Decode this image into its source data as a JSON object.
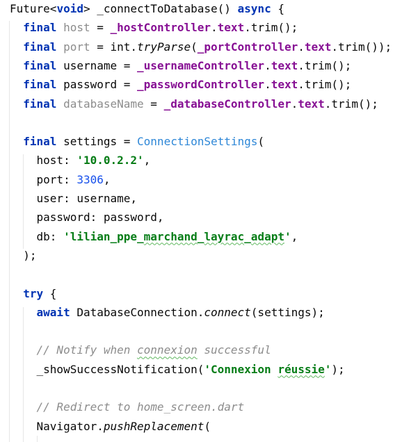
{
  "editor": {
    "lines": [
      [
        [
          "Future<",
          ""
        ],
        [
          "void",
          "kw"
        ],
        [
          "> _connectToDatabase() ",
          ""
        ],
        [
          "async",
          "kw"
        ],
        [
          " {",
          ""
        ]
      ],
      [
        [
          "  ",
          ""
        ],
        [
          "final",
          "kw"
        ],
        [
          " ",
          ""
        ],
        [
          "host",
          "unused"
        ],
        [
          " = ",
          ""
        ],
        [
          "_hostController",
          "field"
        ],
        [
          ".",
          ""
        ],
        [
          "text",
          "field"
        ],
        [
          ".trim();",
          ""
        ]
      ],
      [
        [
          "  ",
          ""
        ],
        [
          "final",
          "kw"
        ],
        [
          " ",
          ""
        ],
        [
          "port",
          "unused"
        ],
        [
          " = int.",
          ""
        ],
        [
          "tryParse",
          "call"
        ],
        [
          "(",
          ""
        ],
        [
          "_portController",
          "field"
        ],
        [
          ".",
          ""
        ],
        [
          "text",
          "field"
        ],
        [
          ".trim());",
          ""
        ]
      ],
      [
        [
          "  ",
          ""
        ],
        [
          "final",
          "kw"
        ],
        [
          " username = ",
          ""
        ],
        [
          "_usernameController",
          "field"
        ],
        [
          ".",
          ""
        ],
        [
          "text",
          "field"
        ],
        [
          ".trim();",
          ""
        ]
      ],
      [
        [
          "  ",
          ""
        ],
        [
          "final",
          "kw"
        ],
        [
          " password = ",
          ""
        ],
        [
          "_passwordController",
          "field"
        ],
        [
          ".",
          ""
        ],
        [
          "text",
          "field"
        ],
        [
          ".trim();",
          ""
        ]
      ],
      [
        [
          "  ",
          ""
        ],
        [
          "final",
          "kw"
        ],
        [
          " ",
          ""
        ],
        [
          "databaseName",
          "unused"
        ],
        [
          " = ",
          ""
        ],
        [
          "_databaseController",
          "field"
        ],
        [
          ".",
          ""
        ],
        [
          "text",
          "field"
        ],
        [
          ".trim();",
          ""
        ]
      ],
      [],
      [
        [
          "  ",
          ""
        ],
        [
          "final",
          "kw"
        ],
        [
          " settings = ",
          ""
        ],
        [
          "ConnectionSettings",
          "cls"
        ],
        [
          "(",
          ""
        ]
      ],
      [
        [
          "    host: ",
          ""
        ],
        [
          "'10.0.2.2'",
          "str"
        ],
        [
          ",",
          ""
        ]
      ],
      [
        [
          "    port: ",
          ""
        ],
        [
          "3306",
          "num"
        ],
        [
          ",",
          ""
        ]
      ],
      [
        [
          "    user: username,",
          ""
        ]
      ],
      [
        [
          "    password: password,",
          ""
        ]
      ],
      [
        [
          "    db: ",
          ""
        ],
        [
          "'lilian_ppe_",
          "str"
        ],
        [
          "marchand",
          "str typo"
        ],
        [
          "_",
          "str"
        ],
        [
          "layrac",
          "str typo"
        ],
        [
          "_",
          "str"
        ],
        [
          "adapt",
          "str typo"
        ],
        [
          "'",
          "str"
        ],
        [
          ",",
          ""
        ]
      ],
      [
        [
          "  );",
          ""
        ]
      ],
      [],
      [
        [
          "  ",
          ""
        ],
        [
          "try",
          "kw"
        ],
        [
          " {",
          ""
        ]
      ],
      [
        [
          "    ",
          ""
        ],
        [
          "await",
          "kw"
        ],
        [
          " DatabaseConnection.",
          ""
        ],
        [
          "connect",
          "call"
        ],
        [
          "(settings);",
          ""
        ]
      ],
      [],
      [
        [
          "    ",
          ""
        ],
        [
          "// Notify when ",
          "comment"
        ],
        [
          "connexion",
          "comment typo"
        ],
        [
          " successful",
          "comment"
        ]
      ],
      [
        [
          "    _showSuccessNotification(",
          ""
        ],
        [
          "'Connexion ",
          "str"
        ],
        [
          "réussie",
          "str typo"
        ],
        [
          "'",
          "str"
        ],
        [
          ");",
          ""
        ]
      ],
      [],
      [
        [
          "    ",
          ""
        ],
        [
          "// Redirect to home_screen.dart",
          "comment"
        ]
      ],
      [
        [
          "    Navigator.",
          ""
        ],
        [
          "pushReplacement",
          "call"
        ],
        [
          "(",
          ""
        ]
      ]
    ]
  }
}
